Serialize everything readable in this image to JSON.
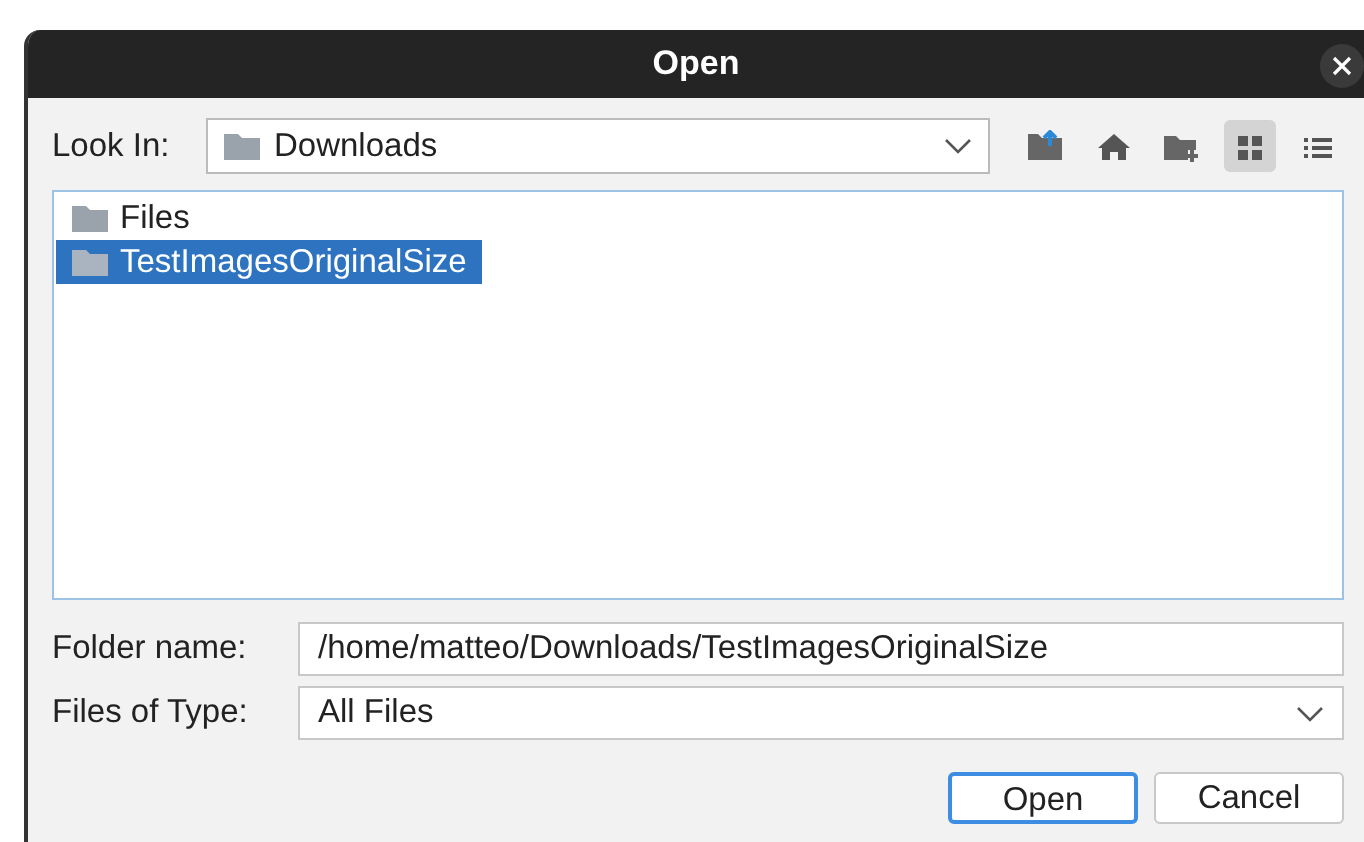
{
  "window": {
    "title": "Open"
  },
  "look_in": {
    "label": "Look In:",
    "value": "Downloads"
  },
  "toolbar": [
    {
      "kind": "up",
      "selected": false
    },
    {
      "kind": "home",
      "selected": false
    },
    {
      "kind": "newfolder",
      "selected": false
    },
    {
      "kind": "grid",
      "selected": true
    },
    {
      "kind": "list",
      "selected": false
    }
  ],
  "files": [
    {
      "name": "Files",
      "selected": false
    },
    {
      "name": "TestImagesOriginalSize",
      "selected": true
    }
  ],
  "folder_name": {
    "label": "Folder name:",
    "value": "/home/matteo/Downloads/TestImagesOriginalSize"
  },
  "files_of_type": {
    "label": "Files of Type:",
    "value": "All Files"
  },
  "buttons": [
    {
      "label": "Open",
      "default": true
    },
    {
      "label": "Cancel",
      "default": false
    }
  ]
}
